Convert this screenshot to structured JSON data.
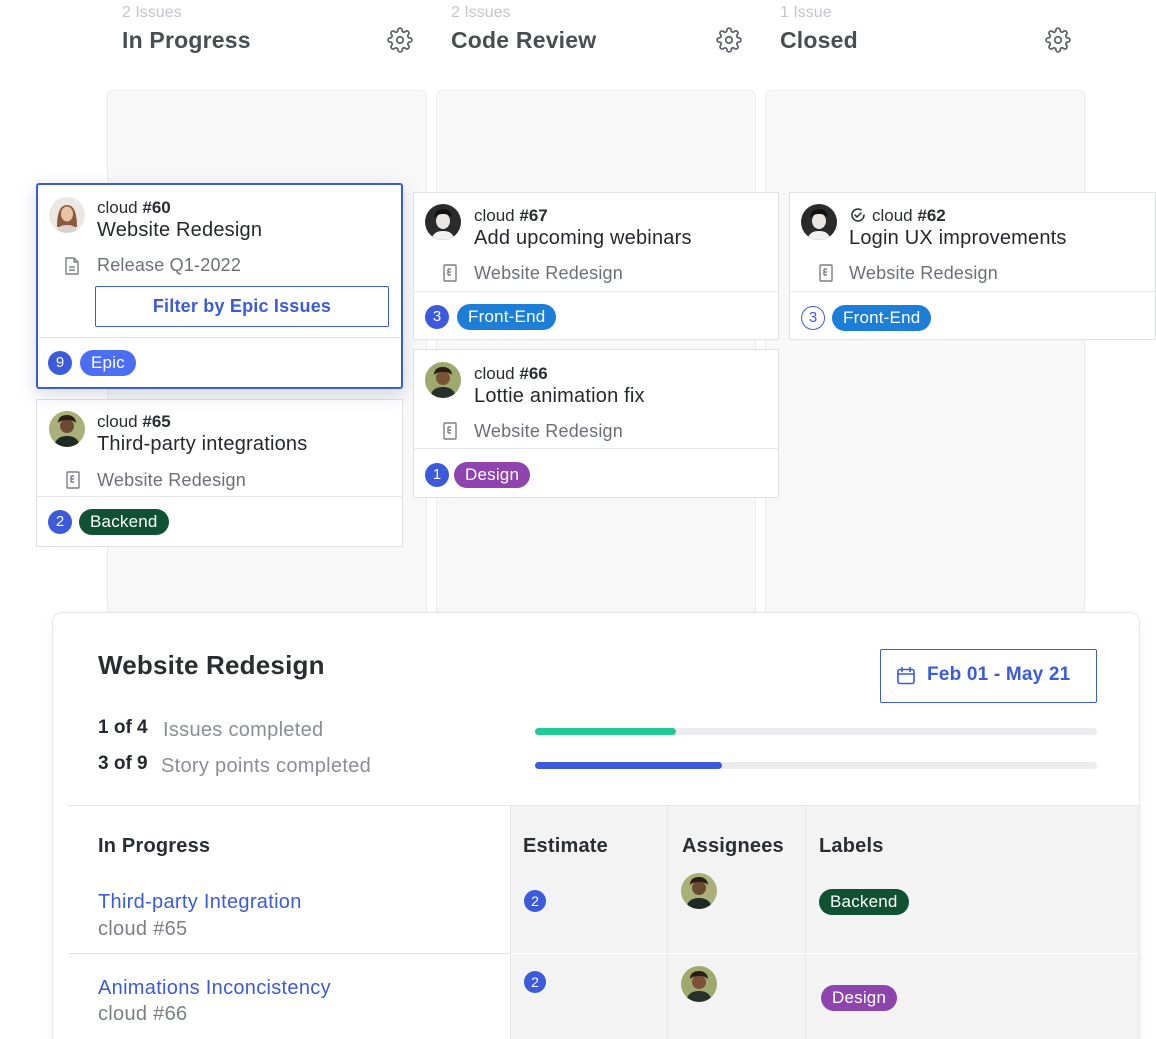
{
  "columns": [
    {
      "count": "2 Issues",
      "title": "In Progress"
    },
    {
      "count": "2 Issues",
      "title": "Code Review"
    },
    {
      "count": "1 Issue",
      "title": "Closed"
    }
  ],
  "cards": {
    "c60": {
      "prefix": "cloud ",
      "number": "#60",
      "title": "Website Redesign",
      "meta": "Release Q1-2022",
      "button": "Filter by Epic Issues",
      "points": "9",
      "label": "Epic"
    },
    "c65": {
      "prefix": "cloud ",
      "number": "#65",
      "title": "Third-party integrations",
      "meta": "Website Redesign",
      "points": "2",
      "label": "Backend"
    },
    "c67": {
      "prefix": "cloud ",
      "number": "#67",
      "title": "Add upcoming webinars",
      "meta": "Website Redesign",
      "points": "3",
      "label": "Front-End"
    },
    "c66": {
      "prefix": "cloud ",
      "number": "#66",
      "title": "Lottie animation fix",
      "meta": "Website Redesign",
      "points": "1",
      "label": "Design"
    },
    "c62": {
      "prefix": "cloud ",
      "number": "#62",
      "title": "Login UX improvements",
      "meta": "Website Redesign",
      "points": "3",
      "label": "Front-End"
    }
  },
  "colors": {
    "accent": "#3b5bdb",
    "backend": "#0f5132",
    "frontend": "#1c7ed6",
    "design": "#8e44ad",
    "epic": "#4c6ef5",
    "progress_green": "#20c997"
  },
  "epic_panel": {
    "title": "Website Redesign",
    "date_range": "Feb 01 - May 21",
    "issues_stat": {
      "value": "1 of 4",
      "text": "Issues completed",
      "completed": 1,
      "total": 4
    },
    "points_stat": {
      "value": "3 of 9",
      "text": "Story points completed",
      "completed": 3,
      "total": 9
    },
    "table": {
      "headers": {
        "status": "In Progress",
        "estimate": "Estimate",
        "assignees": "Assignees",
        "labels": "Labels"
      },
      "rows": [
        {
          "title": "Third-party Integration",
          "id": "cloud #65",
          "estimate": "2",
          "label": "Backend"
        },
        {
          "title": "Animations Inconcistency",
          "id": "cloud #66",
          "estimate": "2",
          "label": "Design"
        }
      ]
    }
  }
}
